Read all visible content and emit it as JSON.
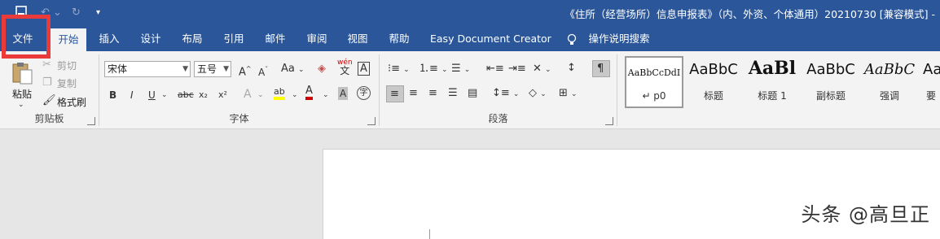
{
  "title_bar": {
    "document_title": "《住所（经营场所）信息申报表》（内、外资、个体通用）20210730 [兼容模式] -",
    "quick_access": [
      "save-icon",
      "undo-icon",
      "redo-icon",
      "customize-icon"
    ]
  },
  "tabs": [
    {
      "label": "文件"
    },
    {
      "label": "开始",
      "active": true
    },
    {
      "label": "插入"
    },
    {
      "label": "设计"
    },
    {
      "label": "布局"
    },
    {
      "label": "引用"
    },
    {
      "label": "邮件"
    },
    {
      "label": "审阅"
    },
    {
      "label": "视图"
    },
    {
      "label": "帮助"
    },
    {
      "label": "Easy Document Creator"
    },
    {
      "label": "操作说明搜索"
    }
  ],
  "clipboard": {
    "label": "剪贴板",
    "paste": "粘贴",
    "cut": "剪切",
    "copy": "复制",
    "format_painter": "格式刷"
  },
  "font": {
    "label": "字体",
    "font_name": "宋体",
    "font_size": "五号",
    "grow": "A",
    "shrink": "A",
    "change_case": "Aa",
    "phonetic": "wén",
    "phonetic_char": "文",
    "border_char": "A",
    "bold": "B",
    "italic": "I",
    "underline": "U",
    "strike": "abc",
    "subscript": "x₂",
    "superscript": "x²",
    "effects": "A",
    "highlight": "ab",
    "font_color": "A",
    "shading": "A",
    "enclose": "字"
  },
  "paragraph": {
    "label": "段落"
  },
  "styles": [
    {
      "sample": "AaBbCcDdI",
      "name": "↵ p0",
      "selected": true
    },
    {
      "sample": "AaBbC",
      "name": "标题"
    },
    {
      "sample": "AaBl",
      "name": "标题 1"
    },
    {
      "sample": "AaBbC",
      "name": "副标题"
    },
    {
      "sample": "AaBbC",
      "name": "强调"
    },
    {
      "sample": "Aa",
      "name": "要"
    }
  ],
  "watermark": "头条 @高旦正",
  "colors": {
    "ribbon_blue": "#2b579a",
    "highlight_red": "#ea3a3a",
    "highlight_yellow": "#ffff00",
    "font_red": "#d00000"
  }
}
